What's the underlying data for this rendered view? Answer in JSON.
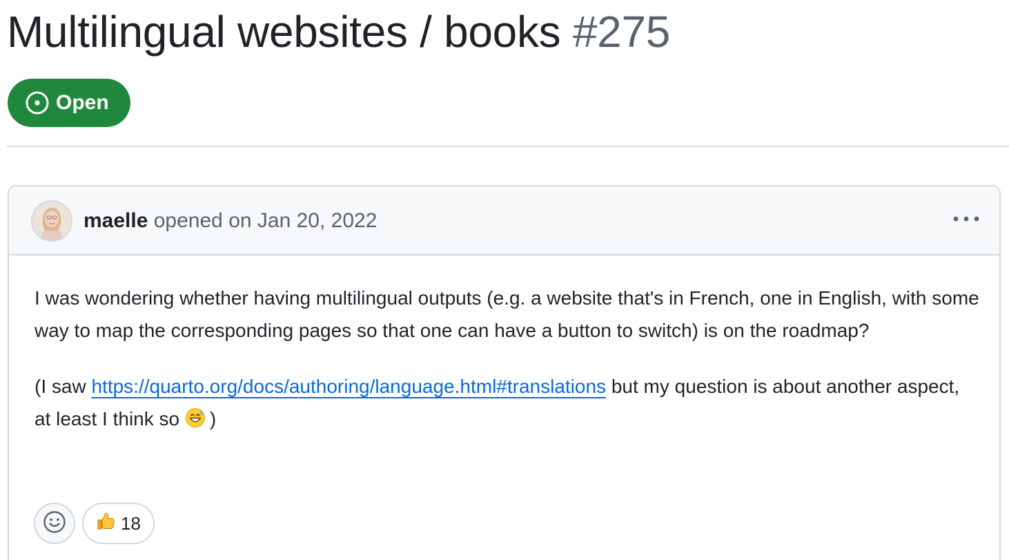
{
  "issue": {
    "title": "Multilingual websites / books",
    "number": "#275",
    "state_label": "Open",
    "state_icon": "issue-opened-icon",
    "state_color": "#1f883d"
  },
  "comment": {
    "author": "maelle",
    "action": "opened on Jan 20, 2022",
    "menu_icon": "kebab-horizontal-icon",
    "paragraph1": "I was wondering whether having multilingual outputs (e.g. a website that's in French, one in English, with some way to map the corresponding pages so that one can have a button to switch) is on the roadmap?",
    "paragraph2": {
      "prefix": "(I saw ",
      "link_text": "https://quarto.org/docs/authoring/language.html#translations",
      "suffix": " but my question is about another aspect, at least I think so ",
      "emoji": "grinning-face-with-sweat",
      "close": ")"
    },
    "reactions": [
      {
        "emoji": "thumbs-up",
        "count": "18"
      }
    ],
    "add_reaction_icon": "smiley-icon"
  },
  "colors": {
    "link": "#0969da",
    "muted_text": "#59636e",
    "border": "#d1d9e0",
    "header_bg": "#f6f8fa"
  }
}
